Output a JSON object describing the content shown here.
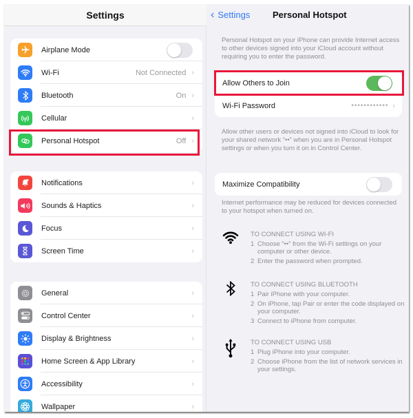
{
  "left": {
    "title": "Settings",
    "groups": [
      {
        "items": [
          {
            "label": "Airplane Mode",
            "icon": "airplane-icon",
            "color": "#f7a02c",
            "control": "toggle",
            "toggle_on": false
          },
          {
            "label": "Wi-Fi",
            "icon": "wifi-icon",
            "color": "#2f7cf6",
            "value": "Not Connected"
          },
          {
            "label": "Bluetooth",
            "icon": "bluetooth-icon",
            "color": "#2f7cf6",
            "value": "On"
          },
          {
            "label": "Cellular",
            "icon": "cellular-antenna-icon",
            "color": "#34c759",
            "value": ""
          },
          {
            "label": "Personal Hotspot",
            "icon": "hotspot-link-icon",
            "color": "#34c759",
            "value": "Off"
          }
        ]
      },
      {
        "items": [
          {
            "label": "Notifications",
            "icon": "bell-icon",
            "color": "#f2453d"
          },
          {
            "label": "Sounds & Haptics",
            "icon": "speaker-icon",
            "color": "#f23a5c"
          },
          {
            "label": "Focus",
            "icon": "moon-icon",
            "color": "#5a57d6"
          },
          {
            "label": "Screen Time",
            "icon": "hourglass-icon",
            "color": "#5a57d6"
          }
        ]
      },
      {
        "items": [
          {
            "label": "General",
            "icon": "gear-icon",
            "color": "#8e8e93"
          },
          {
            "label": "Control Center",
            "icon": "switches-icon",
            "color": "#8e8e93"
          },
          {
            "label": "Display & Brightness",
            "icon": "sun-icon",
            "color": "#2f7cf6"
          },
          {
            "label": "Home Screen & App Library",
            "icon": "app-grid-icon",
            "color": "#5a4fd6"
          },
          {
            "label": "Accessibility",
            "icon": "accessibility-icon",
            "color": "#2f7cf6"
          },
          {
            "label": "Wallpaper",
            "icon": "flower-icon",
            "color": "#35aadc"
          }
        ]
      }
    ],
    "chevron": "›"
  },
  "right": {
    "back_label": "Settings",
    "title": "Personal Hotspot",
    "intro": "Personal Hotspot on your iPhone can provide Internet access to other devices signed into your iCloud account without requiring you to enter the password.",
    "allow_label": "Allow Others to Join",
    "allow_on": true,
    "wifi_password_label": "Wi-Fi Password",
    "wifi_password_value": "••••••••••••",
    "allow_note": "Allow other users or devices not signed into iCloud to look for your shared network “••” when you are in Personal Hotspot settings or when you turn it on in Control Center.",
    "maximize_label": "Maximize Compatibility",
    "maximize_on": false,
    "maximize_note": "Internet performance may be reduced for devices connected to your hotspot when turned on.",
    "connect": [
      {
        "icon": "wifi-icon",
        "heading": "TO CONNECT USING WI-FI",
        "steps": [
          {
            "n": "1",
            "text": "Choose “••” from the Wi-Fi settings on your computer or other device."
          },
          {
            "n": "2",
            "text": "Enter the password when prompted."
          }
        ]
      },
      {
        "icon": "bluetooth-icon",
        "heading": "TO CONNECT USING BLUETOOTH",
        "steps": [
          {
            "n": "1",
            "text": "Pair iPhone with your computer."
          },
          {
            "n": "2",
            "text": "On iPhone, tap Pair or enter the code displayed on your computer."
          },
          {
            "n": "3",
            "text": "Connect to iPhone from computer."
          }
        ]
      },
      {
        "icon": "usb-icon",
        "heading": "TO CONNECT USING USB",
        "steps": [
          {
            "n": "1",
            "text": "Plug iPhone into your computer."
          },
          {
            "n": "2",
            "text": "Choose iPhone from the list of network services in your settings."
          }
        ]
      }
    ]
  },
  "highlight_color": "#e8173b",
  "accent_color": "#3478f6",
  "toggle_on_color": "#5cb85c"
}
